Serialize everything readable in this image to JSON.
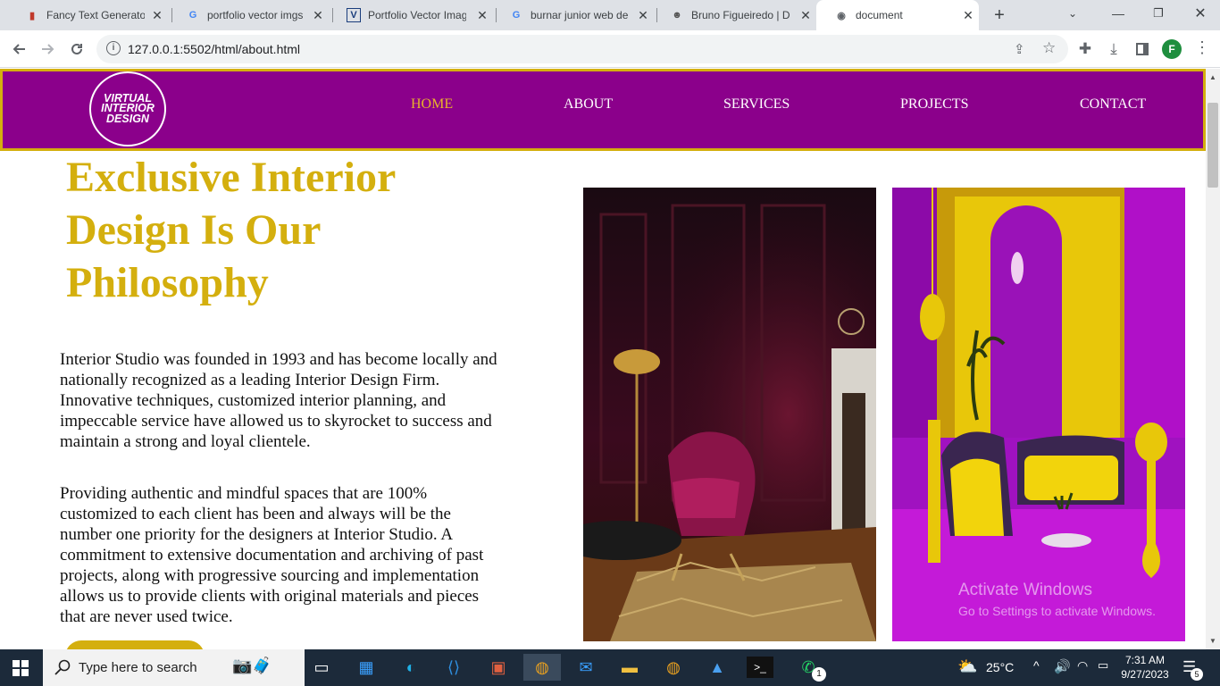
{
  "browser": {
    "tabs": [
      {
        "title": "Fancy Text Generator",
        "icon": "fancy-text-favicon",
        "active": false
      },
      {
        "title": "portfolio vector imgs",
        "icon": "google-favicon",
        "active": false
      },
      {
        "title": "Portfolio Vector Imag",
        "icon": "vectorstock-favicon",
        "active": false
      },
      {
        "title": "burnar junior web de",
        "icon": "google-favicon",
        "active": false
      },
      {
        "title": "Bruno Figueiredo | De",
        "icon": "profile-favicon",
        "active": false
      },
      {
        "title": "document",
        "icon": "globe-favicon",
        "active": true
      }
    ],
    "url": "127.0.0.1:5502/html/about.html",
    "profile_initial": "F"
  },
  "site": {
    "logo_lines": [
      "VIRTUAL",
      "INTERIOR",
      "DESIGN"
    ],
    "nav": [
      {
        "label": "HOME",
        "active": true
      },
      {
        "label": "ABOUT",
        "active": false
      },
      {
        "label": "SERVICES",
        "active": false
      },
      {
        "label": "PROJECTS",
        "active": false
      },
      {
        "label": "CONTACT",
        "active": false
      }
    ],
    "hero_title": "Exclusive Interior Design Is Our Philosophy",
    "paragraph1": "Interior Studio was founded in 1993 and has become locally and nationally recognized as a leading Interior Design Firm. Innovative techniques, customized interior planning, and impeccable service have allowed us to skyrocket to success and maintain a strong and loyal clientele.",
    "paragraph2": "Providing authentic and mindful spaces that are 100% customized to each client has been and always will be the number one priority for the designers at Interior Studio. A commitment to extensive documentation and archiving of past projects, along with progressive sourcing and implementation allows us to provide clients with original materials and pieces that are never used twice."
  },
  "watermark": {
    "line1": "Activate Windows",
    "line2": "Go to Settings to activate Windows."
  },
  "taskbar": {
    "search_placeholder": "Type here to search",
    "weather": "25°C",
    "time": "7:31 AM",
    "date": "9/27/2023",
    "notification_count": "5",
    "whatsapp_badge": "1"
  },
  "colors": {
    "brand_purple": "#8b008b",
    "brand_gold": "#d4af0e",
    "nav_active": "#e8b32c"
  }
}
